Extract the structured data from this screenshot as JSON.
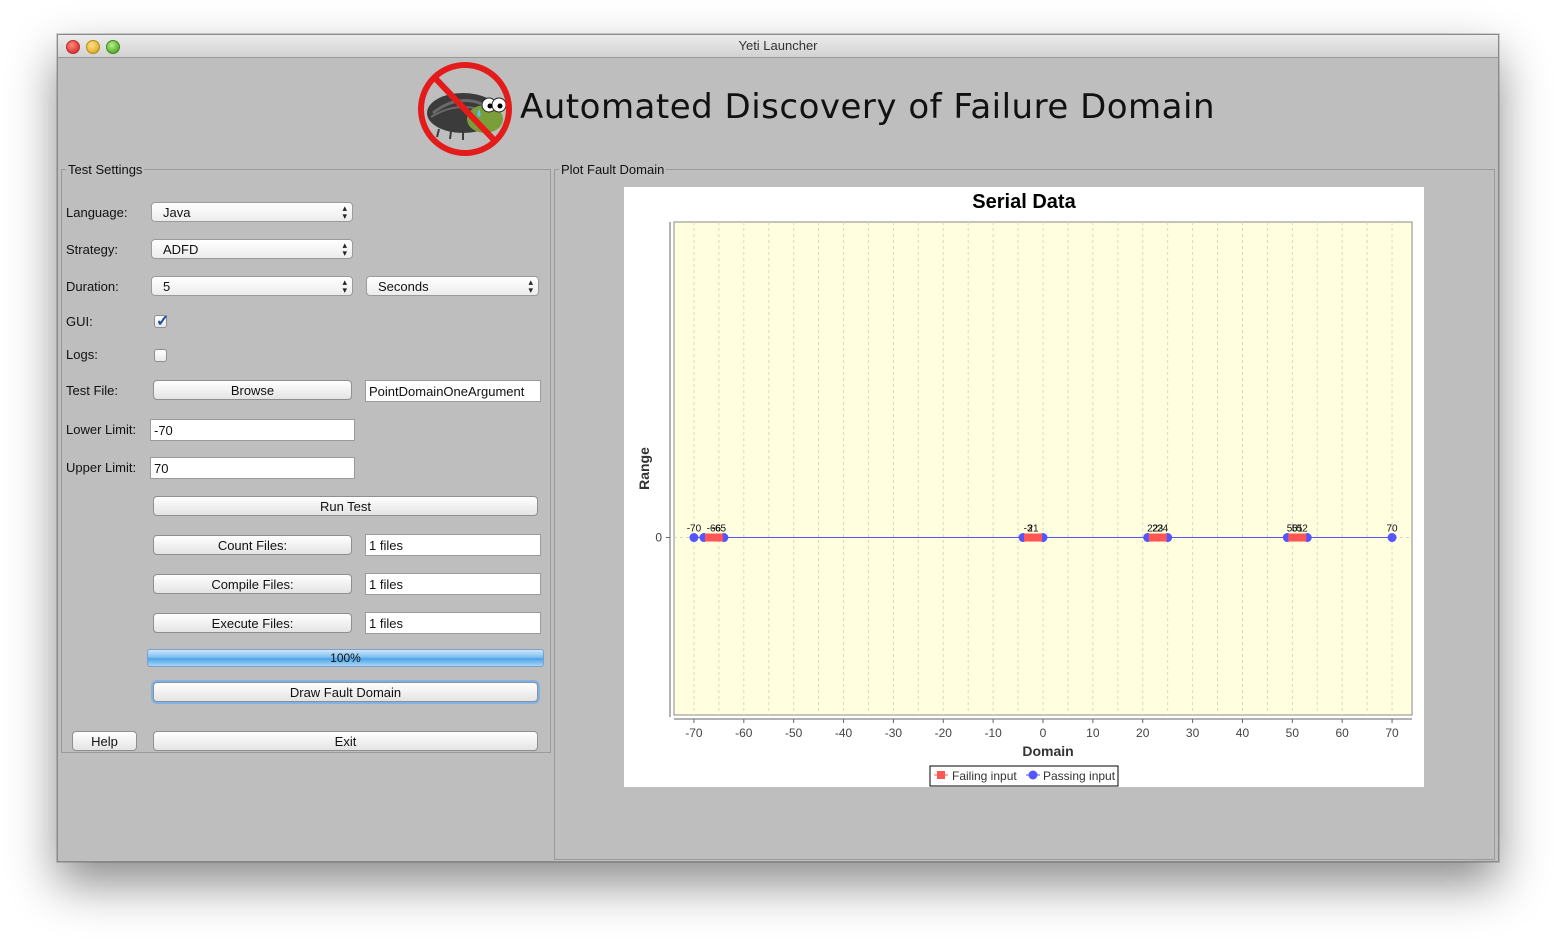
{
  "window": {
    "title": "Yeti Launcher"
  },
  "header": {
    "title": "Automated Discovery of Failure Domain",
    "logo_icon": "no-bug-logo-icon"
  },
  "settings": {
    "legend": "Test Settings",
    "language_label": "Language:",
    "language_value": "Java",
    "strategy_label": "Strategy:",
    "strategy_value": "ADFD",
    "duration_label": "Duration:",
    "duration_value": "5",
    "duration_unit": "Seconds",
    "gui_label": "GUI:",
    "gui_checked": true,
    "logs_label": "Logs:",
    "logs_checked": false,
    "test_file_label": "Test File:",
    "browse_label": "Browse",
    "test_file_value": "PointDomainOneArgument",
    "lower_limit_label": "Lower Limit:",
    "lower_limit_value": "-70",
    "upper_limit_label": "Upper Limit:",
    "upper_limit_value": "70",
    "run_test_label": "Run Test",
    "count_files_label": "Count Files:",
    "count_files_value": "1 files",
    "compile_files_label": "Compile Files:",
    "compile_files_value": "1 files",
    "execute_files_label": "Execute Files:",
    "execute_files_value": "1 files",
    "progress_text": "100%",
    "progress": 1.0,
    "draw_fault_domain_label": "Draw Fault Domain",
    "help_label": "Help",
    "exit_label": "Exit"
  },
  "plot": {
    "legend": "Plot Fault Domain"
  },
  "colors": {
    "failing": "#ff5555",
    "passing": "#5555ff",
    "plot_bg": "#ffffe0"
  },
  "chart_data": {
    "type": "scatter",
    "title": "Serial Data",
    "xlabel": "Domain",
    "ylabel": "Range",
    "xlim": [
      -74,
      74
    ],
    "xticks": [
      -70,
      -60,
      -50,
      -40,
      -30,
      -20,
      -10,
      0,
      10,
      20,
      30,
      40,
      50,
      60,
      70
    ],
    "yticks": [
      0
    ],
    "grid": true,
    "legend_position": "bottom",
    "series": [
      {
        "name": "Failing input",
        "x": [
          -67,
          -66,
          -65,
          -3,
          -2,
          -1,
          22,
          23,
          24,
          50,
          51,
          52
        ],
        "y": [
          0,
          0,
          0,
          0,
          0,
          0,
          0,
          0,
          0,
          0,
          0,
          0
        ]
      },
      {
        "name": "Passing input",
        "x": [
          -70,
          -68,
          -64,
          -4,
          0,
          21,
          25,
          49,
          53,
          70
        ],
        "y": [
          0,
          0,
          0,
          0,
          0,
          0,
          0,
          0,
          0,
          0
        ]
      }
    ],
    "point_labels": [
      {
        "x": -70,
        "text": "-70"
      },
      {
        "x": -66,
        "text": "-66"
      },
      {
        "x": -65,
        "text": "-65"
      },
      {
        "x": -3,
        "text": "-3"
      },
      {
        "x": -2,
        "text": "21"
      },
      {
        "x": 22,
        "text": "22"
      },
      {
        "x": 23,
        "text": "23"
      },
      {
        "x": 24,
        "text": "24"
      },
      {
        "x": 50,
        "text": "50"
      },
      {
        "x": 51,
        "text": "51"
      },
      {
        "x": 52,
        "text": "52"
      },
      {
        "x": 70,
        "text": "70"
      }
    ]
  }
}
